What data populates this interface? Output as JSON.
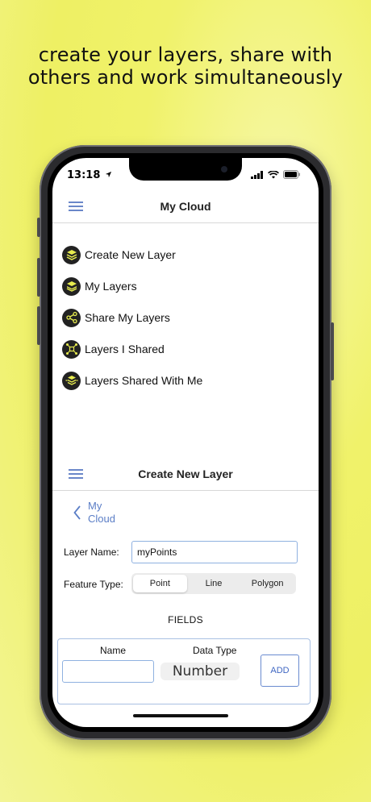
{
  "headline": {
    "line1": "create your layers, share with",
    "line2": "others and work simultaneously"
  },
  "status_bar": {
    "time": "13:18"
  },
  "screen1": {
    "title": "My Cloud",
    "menu": [
      {
        "label": "Create New Layer",
        "icon": "layer-add-icon"
      },
      {
        "label": "My Layers",
        "icon": "layers-icon"
      },
      {
        "label": "Share My Layers",
        "icon": "share-icon"
      },
      {
        "label": "Layers I Shared",
        "icon": "shared-network-icon"
      },
      {
        "label": "Layers Shared With Me",
        "icon": "shared-with-me-icon"
      }
    ]
  },
  "screen2": {
    "title": "Create New Layer",
    "back_line1": "My",
    "back_line2": "Cloud",
    "layer_name_label": "Layer Name:",
    "layer_name_value": "myPoints",
    "feature_type_label": "Feature Type:",
    "feature_types": [
      "Point",
      "Line",
      "Polygon"
    ],
    "feature_type_selected": "Point",
    "fields_title": "FIELDS",
    "name_col": "Name",
    "data_type_col": "Data Type",
    "name_value": "",
    "data_type_value": "Number",
    "add_label": "ADD"
  },
  "colors": {
    "background": "#eef064",
    "accent": "#5b7ec6",
    "icon_yellow": "#e7ec4f"
  }
}
